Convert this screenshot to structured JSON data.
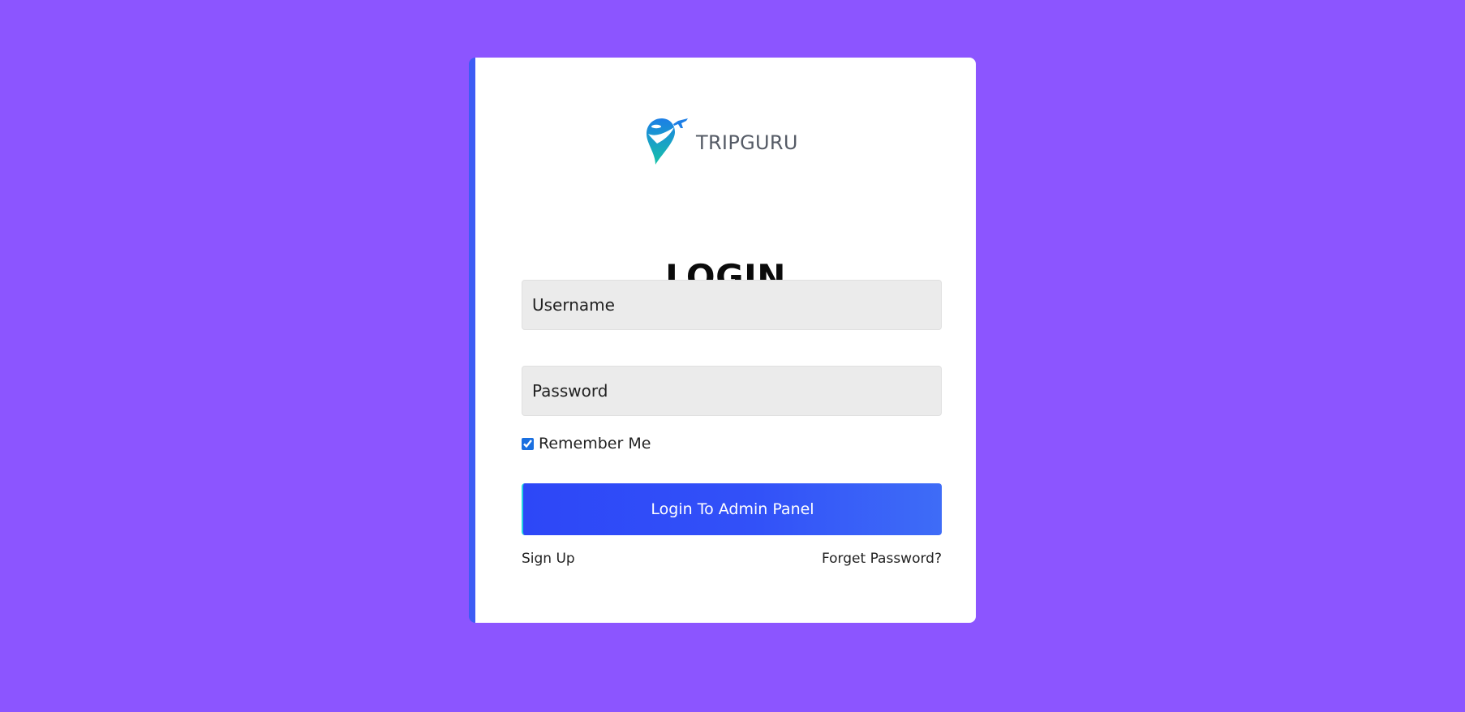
{
  "colors": {
    "background": "#8c55ff",
    "card": "#ffffff",
    "accent_border": "#3d5cf5",
    "button_gradient_start": "#2d47f7",
    "button_gradient_end": "#3e6cf7",
    "input_background": "#ebebeb"
  },
  "logo": {
    "icon": "map-pin-airplane-icon",
    "brand": "TRIPGURU"
  },
  "login": {
    "title": "LOGIN",
    "username_placeholder": "Username",
    "password_placeholder": "Password",
    "remember_label": "Remember Me",
    "remember_checked": true,
    "submit_label": "Login To Admin Panel",
    "signup_label": "Sign Up",
    "forget_label": "Forget Password?"
  }
}
